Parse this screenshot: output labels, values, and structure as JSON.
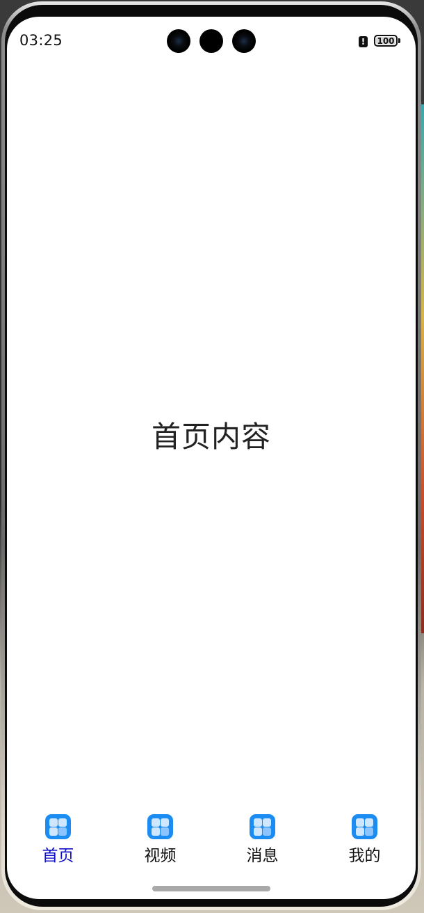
{
  "status_bar": {
    "time": "03:25",
    "alert_icon": "alert-icon",
    "alert_glyph": "!",
    "battery_level": "100"
  },
  "main": {
    "content_text": "首页内容"
  },
  "tabbar": {
    "active_index": 0,
    "active_color": "#1010c8",
    "icon_color": "#1b8cf2",
    "tabs": [
      {
        "label": "首页",
        "icon": "grid-icon"
      },
      {
        "label": "视频",
        "icon": "grid-icon"
      },
      {
        "label": "消息",
        "icon": "grid-icon"
      },
      {
        "label": "我的",
        "icon": "grid-icon"
      }
    ]
  }
}
